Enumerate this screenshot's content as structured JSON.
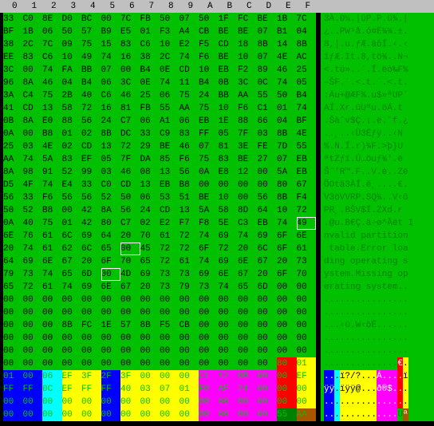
{
  "header": [
    "0",
    "1",
    "2",
    "3",
    "4",
    "5",
    "6",
    "7",
    "8",
    "9",
    "A",
    "B",
    "C",
    "D",
    "E",
    "F"
  ],
  "rows": [
    {
      "hex": [
        "33",
        "C0",
        "8E",
        "D0",
        "BC",
        "00",
        "7C",
        "FB",
        "50",
        "07",
        "50",
        "1F",
        "FC",
        "BE",
        "1B",
        "7C"
      ],
      "ascii": "3À.Ð¼.|ûP.P.ü¾.|",
      "seg": [
        [
          "g",
          16
        ]
      ]
    },
    {
      "hex": [
        "BF",
        "1B",
        "06",
        "50",
        "57",
        "B9",
        "E5",
        "01",
        "F3",
        "A4",
        "CB",
        "BE",
        "BE",
        "07",
        "B1",
        "04"
      ],
      "ascii": "¿..PW¹å.ó¤Ë¾¾.±.",
      "seg": [
        [
          "g",
          16
        ]
      ]
    },
    {
      "hex": [
        "38",
        "2C",
        "7C",
        "09",
        "75",
        "15",
        "83",
        "C6",
        "10",
        "E2",
        "F5",
        "CD",
        "18",
        "8B",
        "14",
        "8B"
      ],
      "ascii": "8,|.u.ƒÆ.âõÍ.‹.‹",
      "seg": [
        [
          "g",
          16
        ]
      ]
    },
    {
      "hex": [
        "EE",
        "83",
        "C6",
        "10",
        "49",
        "74",
        "16",
        "38",
        "2C",
        "74",
        "F6",
        "BE",
        "10",
        "07",
        "4E",
        "AC"
      ],
      "ascii": "îƒÆ.It.8,tö¾..N¬",
      "seg": [
        [
          "g",
          16
        ]
      ]
    },
    {
      "hex": [
        "3C",
        "00",
        "74",
        "FA",
        "BB",
        "07",
        "00",
        "B4",
        "0E",
        "CD",
        "10",
        "EB",
        "F2",
        "89",
        "46",
        "25"
      ],
      "ascii": "<.tú»..´.Í.ëò‰F%",
      "seg": [
        [
          "g",
          16
        ]
      ]
    },
    {
      "hex": [
        "96",
        "8A",
        "46",
        "04",
        "B4",
        "06",
        "3C",
        "0E",
        "74",
        "11",
        "B4",
        "0B",
        "3C",
        "0C",
        "74",
        "05"
      ],
      "ascii": "–ŠF.´.<.t.´.<.t.",
      "seg": [
        [
          "g",
          16
        ]
      ]
    },
    {
      "hex": [
        "3A",
        "C4",
        "75",
        "2B",
        "40",
        "C6",
        "46",
        "25",
        "06",
        "75",
        "24",
        "BB",
        "AA",
        "55",
        "50",
        "B4"
      ],
      "ascii": ":Äu+@ÆF%.u$»ªUP´",
      "seg": [
        [
          "g",
          16
        ]
      ]
    },
    {
      "hex": [
        "41",
        "CD",
        "13",
        "58",
        "72",
        "16",
        "81",
        "FB",
        "55",
        "AA",
        "75",
        "10",
        "F6",
        "C1",
        "01",
        "74"
      ],
      "ascii": "AÍ.Xr.ûUªu.öÁ.t",
      "seg": [
        [
          "g",
          16
        ]
      ]
    },
    {
      "hex": [
        "0B",
        "8A",
        "E0",
        "88",
        "56",
        "24",
        "C7",
        "06",
        "A1",
        "06",
        "EB",
        "1E",
        "88",
        "66",
        "04",
        "BF"
      ],
      "ascii": ".Šàˆv$Ç.¡.ë.ˆf.¿",
      "seg": [
        [
          "g",
          16
        ]
      ]
    },
    {
      "hex": [
        "0A",
        "00",
        "B8",
        "01",
        "02",
        "8B",
        "DC",
        "33",
        "C9",
        "83",
        "FF",
        "05",
        "7F",
        "03",
        "8B",
        "4E"
      ],
      "ascii": "..¸..‹Ü3Éƒÿ..‹N",
      "seg": [
        [
          "g",
          16
        ]
      ]
    },
    {
      "hex": [
        "25",
        "03",
        "4E",
        "02",
        "CD",
        "13",
        "72",
        "29",
        "BE",
        "46",
        "07",
        "81",
        "3E",
        "FE",
        "7D",
        "55"
      ],
      "ascii": "%.N.Í.r)¾F.>þ}U",
      "seg": [
        [
          "g",
          16
        ]
      ]
    },
    {
      "hex": [
        "AA",
        "74",
        "5A",
        "83",
        "EF",
        "05",
        "7F",
        "DA",
        "85",
        "F6",
        "75",
        "83",
        "BE",
        "27",
        "07",
        "EB"
      ],
      "ascii": "ªtZƒï.Ú…öuƒ¾'.ë",
      "seg": [
        [
          "g",
          16
        ]
      ]
    },
    {
      "hex": [
        "8A",
        "98",
        "91",
        "52",
        "99",
        "03",
        "46",
        "08",
        "13",
        "56",
        "0A",
        "E8",
        "12",
        "00",
        "5A",
        "EB"
      ],
      "ascii": "Š˜'R™.F..V.è..Zë",
      "seg": [
        [
          "g",
          16
        ]
      ]
    },
    {
      "hex": [
        "D5",
        "4F",
        "74",
        "E4",
        "33",
        "C0",
        "CD",
        "13",
        "EB",
        "B8",
        "00",
        "00",
        "00",
        "00",
        "80",
        "67"
      ],
      "ascii": "ÕOtä3ÀÍ.ë¸....€.",
      "seg": [
        [
          "g",
          16
        ]
      ]
    },
    {
      "hex": [
        "56",
        "33",
        "F6",
        "56",
        "56",
        "52",
        "50",
        "06",
        "53",
        "51",
        "BE",
        "10",
        "00",
        "56",
        "8B",
        "F4"
      ],
      "ascii": "V3öVVRP.SQ¾..V‹ô",
      "seg": [
        [
          "g",
          16
        ]
      ]
    },
    {
      "hex": [
        "50",
        "52",
        "B8",
        "00",
        "42",
        "8A",
        "56",
        "24",
        "CD",
        "13",
        "5A",
        "58",
        "8D",
        "64",
        "10",
        "72"
      ],
      "ascii": "PR¸.BŠV$Í.ZXd.r",
      "seg": [
        [
          "g",
          16
        ]
      ]
    },
    {
      "hex": [
        "0A",
        "40",
        "75",
        "01",
        "42",
        "80",
        "C7",
        "02",
        "E2",
        "F7",
        "F8",
        "5E",
        "C3",
        "EB",
        "74",
        "49"
      ],
      "ascii": ".@u.B€Ç.â÷ø^Ãët I",
      "seg": [
        [
          "g",
          14
        ],
        [
          "g",
          1
        ],
        [
          "gh",
          1
        ]
      ],
      "hl": [
        15
      ]
    },
    {
      "hex": [
        "6E",
        "76",
        "61",
        "6C",
        "69",
        "64",
        "20",
        "70",
        "61",
        "72",
        "74",
        "69",
        "74",
        "69",
        "6F",
        "6E"
      ],
      "ascii": "nvalid partition",
      "seg": [
        [
          "g",
          16
        ]
      ]
    },
    {
      "hex": [
        "20",
        "74",
        "61",
        "62",
        "6C",
        "65",
        "00",
        "45",
        "72",
        "72",
        "6F",
        "72",
        "20",
        "6C",
        "6F",
        "61"
      ],
      "ascii": " table.Error loa",
      "seg": [
        [
          "g",
          6
        ],
        [
          "gh",
          1
        ],
        [
          "g",
          9
        ]
      ],
      "hl": [
        6
      ]
    },
    {
      "hex": [
        "64",
        "69",
        "6E",
        "67",
        "20",
        "6F",
        "70",
        "65",
        "72",
        "61",
        "74",
        "69",
        "6E",
        "67",
        "20",
        "73"
      ],
      "ascii": "ding operating s",
      "seg": [
        [
          "g",
          16
        ]
      ]
    },
    {
      "hex": [
        "79",
        "73",
        "74",
        "65",
        "6D",
        "00",
        "4D",
        "69",
        "73",
        "73",
        "69",
        "6E",
        "67",
        "20",
        "6F",
        "70"
      ],
      "ascii": "ystem.Missing op",
      "seg": [
        [
          "g",
          5
        ],
        [
          "gh",
          1
        ],
        [
          "g",
          10
        ]
      ],
      "hl": [
        5
      ]
    },
    {
      "hex": [
        "65",
        "72",
        "61",
        "74",
        "69",
        "6E",
        "67",
        "20",
        "73",
        "79",
        "73",
        "74",
        "65",
        "6D",
        "00",
        "00"
      ],
      "ascii": "erating system..",
      "seg": [
        [
          "g",
          16
        ]
      ]
    },
    {
      "hex": [
        "00",
        "00",
        "00",
        "00",
        "00",
        "00",
        "00",
        "00",
        "00",
        "00",
        "00",
        "00",
        "00",
        "00",
        "00",
        "00"
      ],
      "ascii": "................",
      "seg": [
        [
          "g",
          16
        ]
      ]
    },
    {
      "hex": [
        "00",
        "00",
        "00",
        "00",
        "00",
        "00",
        "00",
        "00",
        "00",
        "00",
        "00",
        "00",
        "00",
        "00",
        "00",
        "00"
      ],
      "ascii": "................",
      "seg": [
        [
          "g",
          16
        ]
      ]
    },
    {
      "hex": [
        "00",
        "00",
        "00",
        "8B",
        "FC",
        "1E",
        "57",
        "8B",
        "F5",
        "CB",
        "00",
        "00",
        "00",
        "00",
        "00",
        "00"
      ],
      "ascii": "...‹ü.W‹õË......",
      "seg": [
        [
          "g",
          16
        ]
      ]
    },
    {
      "hex": [
        "00",
        "00",
        "00",
        "00",
        "00",
        "00",
        "00",
        "00",
        "00",
        "00",
        "00",
        "00",
        "00",
        "00",
        "00",
        "00"
      ],
      "ascii": "................",
      "seg": [
        [
          "g",
          16
        ]
      ]
    },
    {
      "hex": [
        "00",
        "00",
        "00",
        "00",
        "00",
        "00",
        "00",
        "00",
        "00",
        "00",
        "00",
        "00",
        "00",
        "00",
        "00",
        "00"
      ],
      "ascii": "................",
      "seg": [
        [
          "g",
          16
        ]
      ]
    },
    {
      "hex": [
        "00",
        "00",
        "00",
        "00",
        "00",
        "00",
        "00",
        "00",
        "00",
        "00",
        "00",
        "00",
        "00",
        "00",
        "80",
        "01"
      ],
      "ascii": "..............€.",
      "seg": [
        [
          "g",
          14
        ],
        [
          "r",
          1
        ],
        [
          "y",
          1
        ]
      ],
      "aseg": [
        [
          "g",
          14
        ],
        [
          "r",
          1
        ],
        [
          "y",
          1
        ]
      ]
    },
    {
      "hex": [
        "01",
        "00",
        "06",
        "EF",
        "3F",
        "2F",
        "3F",
        "00",
        "00",
        "00",
        "C1",
        "12",
        "0B",
        "00",
        "00",
        "EF"
      ],
      "ascii": "...ï?/?...Á....ï",
      "seg": [
        [
          "b",
          2
        ],
        [
          "c",
          1
        ],
        [
          "y",
          2
        ],
        [
          "b",
          1
        ],
        [
          "y",
          4
        ],
        [
          "m",
          4
        ],
        [
          "r",
          1
        ],
        [
          "y",
          1
        ]
      ],
      "aseg": [
        [
          "b",
          2
        ],
        [
          "c",
          1
        ],
        [
          "y",
          3
        ],
        [
          "y",
          4
        ],
        [
          "m",
          4
        ],
        [
          "r",
          1
        ],
        [
          "y",
          1
        ]
      ]
    },
    {
      "hex": [
        "FF",
        "FF",
        "0C",
        "EF",
        "FF",
        "FF",
        "40",
        "03",
        "07",
        "01",
        "F0",
        "AE",
        "24",
        "00",
        "00",
        "00"
      ],
      "ascii": "ÿÿ.ïÿÿ@...ð®$...",
      "seg": [
        [
          "b",
          2
        ],
        [
          "c",
          1
        ],
        [
          "y",
          2
        ],
        [
          "b",
          1
        ],
        [
          "y",
          4
        ],
        [
          "m",
          4
        ],
        [
          "r",
          1
        ],
        [
          "y",
          1
        ]
      ],
      "aseg": [
        [
          "b",
          2
        ],
        [
          "c",
          1
        ],
        [
          "y",
          3
        ],
        [
          "y",
          4
        ],
        [
          "m",
          4
        ],
        [
          "r",
          1
        ],
        [
          "y",
          1
        ]
      ]
    },
    {
      "hex": [
        "00",
        "00",
        "00",
        "00",
        "00",
        "00",
        "00",
        "00",
        "00",
        "00",
        "00",
        "00",
        "00",
        "00",
        "00",
        "00"
      ],
      "ascii": "................",
      "seg": [
        [
          "b",
          2
        ],
        [
          "c",
          1
        ],
        [
          "y",
          2
        ],
        [
          "b",
          1
        ],
        [
          "y",
          4
        ],
        [
          "m",
          4
        ],
        [
          "r",
          1
        ],
        [
          "y",
          1
        ]
      ],
      "aseg": [
        [
          "b",
          2
        ],
        [
          "c",
          1
        ],
        [
          "y",
          3
        ],
        [
          "y",
          4
        ],
        [
          "m",
          4
        ],
        [
          "r",
          1
        ],
        [
          "y",
          1
        ]
      ]
    },
    {
      "hex": [
        "00",
        "00",
        "00",
        "00",
        "00",
        "00",
        "00",
        "00",
        "00",
        "00",
        "00",
        "00",
        "00",
        "00",
        "55",
        "AA"
      ],
      "ascii": "..............Uª",
      "seg": [
        [
          "b",
          2
        ],
        [
          "c",
          1
        ],
        [
          "y",
          2
        ],
        [
          "b",
          1
        ],
        [
          "y",
          4
        ],
        [
          "m",
          4
        ],
        [
          "dg",
          1
        ],
        [
          "br",
          1
        ]
      ],
      "aseg": [
        [
          "b",
          2
        ],
        [
          "c",
          1
        ],
        [
          "y",
          3
        ],
        [
          "y",
          4
        ],
        [
          "m",
          4
        ],
        [
          "g",
          1
        ],
        [
          "br",
          1
        ]
      ]
    }
  ]
}
